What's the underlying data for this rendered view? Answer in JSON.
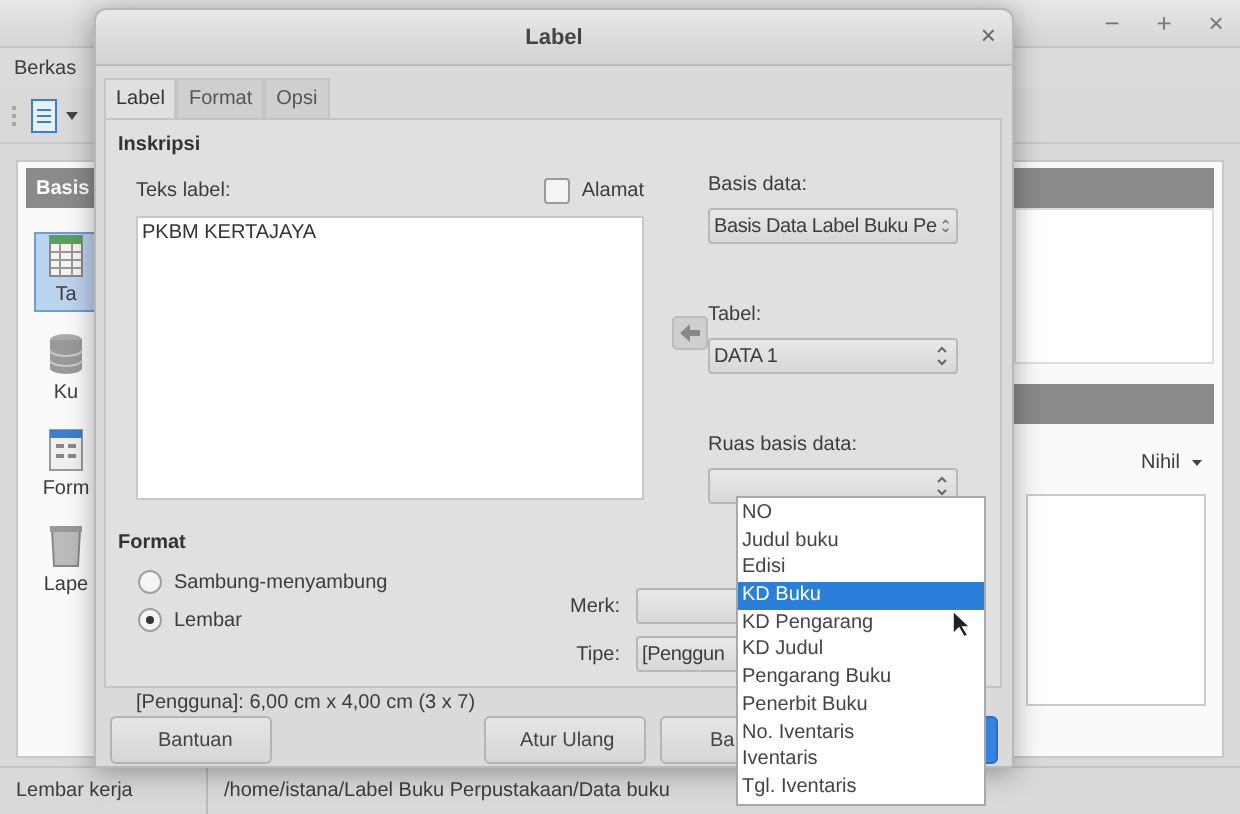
{
  "app": {
    "window_controls": [
      "−",
      "+",
      "×"
    ],
    "menu": [
      "Berkas"
    ],
    "sidebar": {
      "title": "Basis",
      "items": [
        {
          "label": "Ta",
          "kind": "table",
          "selected": true
        },
        {
          "label": "Ku",
          "kind": "query",
          "selected": false
        },
        {
          "label": "Form",
          "kind": "form",
          "selected": false
        },
        {
          "label": "Lape",
          "kind": "report",
          "selected": false
        }
      ]
    },
    "right_panel": {
      "dropdown": "Nihil"
    },
    "status_bar": [
      "Lembar kerja",
      "/home/istana/Label Buku Perpustakaan/Data buku"
    ]
  },
  "dialog": {
    "title": "Label",
    "close": "×",
    "tabs": [
      {
        "label": "Label",
        "selected": true
      },
      {
        "label": "Format",
        "selected": false
      },
      {
        "label": "Opsi",
        "selected": false
      }
    ],
    "inscription": {
      "heading": "Inskripsi",
      "label_text_caption": "Teks label:",
      "address": {
        "label": "Alamat",
        "checked": false
      },
      "label_text": "PKBM KERTAJAYA",
      "database_caption": "Basis data:",
      "database": "Basis Data Label Buku Pe",
      "table_caption": "Tabel:",
      "table": "DATA 1",
      "field_caption": "Ruas basis data:"
    },
    "field_options": [
      {
        "label": "NO",
        "selected": false
      },
      {
        "label": "Judul buku",
        "selected": false
      },
      {
        "label": "Edisi",
        "selected": false
      },
      {
        "label": "KD Buku",
        "selected": true
      },
      {
        "label": "KD Pengarang",
        "selected": false
      },
      {
        "label": "KD Judul",
        "selected": false
      },
      {
        "label": "Pengarang Buku",
        "selected": false
      },
      {
        "label": "Penerbit Buku",
        "selected": false
      },
      {
        "label": "No. Iventaris",
        "selected": false
      },
      {
        "label": "Iventaris",
        "selected": false
      },
      {
        "label": "Tgl. Iventaris",
        "selected": false
      }
    ],
    "format": {
      "heading": "Format",
      "options": [
        {
          "label": "Sambung-menyambung",
          "selected": false
        },
        {
          "label": "Lembar",
          "selected": true
        }
      ],
      "brand_caption": "Merk:",
      "type_caption": "Tipe:",
      "type": "[Penggun",
      "summary": "[Pengguna]: 6,00 cm x 4,00 cm (3 x 7)"
    },
    "buttons": [
      {
        "label": "Bantuan",
        "kind": "normal"
      },
      {
        "label": "Atur Ulang",
        "kind": "normal"
      },
      {
        "label": "Ba",
        "kind": "normal"
      },
      {
        "kind": "primary"
      }
    ]
  }
}
